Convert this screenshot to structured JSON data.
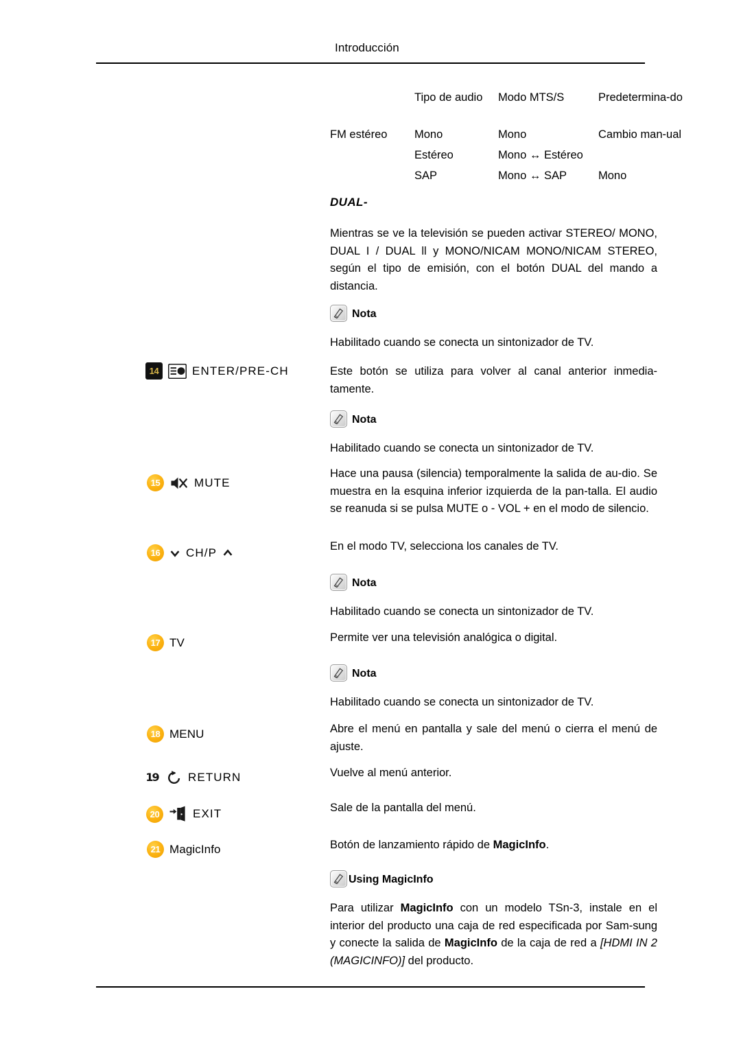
{
  "header": {
    "title": "Introducción"
  },
  "audio_table": {
    "columns": [
      "",
      "Tipo de audio",
      "Modo MTS/S",
      "Predetermina-do"
    ],
    "header_cells": {
      "type": "Tipo de audio",
      "mode": "Modo MTS/S",
      "default": "Predetermina-do"
    },
    "row_label": "FM estéreo",
    "rows": [
      {
        "audio_type": "Mono",
        "mts_mode": "Mono",
        "default": "Cambio  man-ual"
      },
      {
        "audio_type": "Estéreo",
        "mts_mode": "Mono ↔ Estéreo",
        "default": ""
      },
      {
        "audio_type": "SAP",
        "mts_mode": "Mono ↔ SAP",
        "default": "Mono"
      }
    ]
  },
  "dual_section": {
    "heading": "DUAL-",
    "paragraph": "Mientras se ve la televisión se pueden activar STEREO/ MONO, DUAL I / DUAL ll y MONO/NICAM MONO/NICAM STEREO, según el tipo de emisión, con el botón DUAL del mando a distancia."
  },
  "notes": {
    "label": "Nota",
    "tuner_text": "Habilitado cuando se conecta un sintonizador de TV."
  },
  "entries": [
    {
      "id": "enter-pre-ch",
      "badge": "14",
      "badge_style": "dark",
      "icon": "channel-list-icon",
      "label": "ENTER/PRE-CH",
      "description": "Este botón se utiliza para volver al canal anterior inmedia-tamente."
    },
    {
      "id": "mute",
      "badge": "15",
      "badge_style": "orange",
      "icon": "speaker-mute-icon",
      "label": "MUTE",
      "description": "Hace una pausa (silencia) temporalmente la salida de au-dio. Se muestra en la esquina inferior izquierda de la pan-talla. El audio se reanuda si se pulsa MUTE o - VOL + en el modo de silencio."
    },
    {
      "id": "ch-p",
      "badge": "16",
      "badge_style": "orange",
      "icon": "chevron-down-icon",
      "icon_right": "chevron-up-icon",
      "label": "CH/P",
      "description": "En el modo TV, selecciona los canales de TV.",
      "description_bold": "TV"
    },
    {
      "id": "tv",
      "badge": "17",
      "badge_style": "orange",
      "label": "TV",
      "description": "Permite ver una televisión analógica o digital."
    },
    {
      "id": "menu",
      "badge": "18",
      "badge_style": "orange",
      "label": "MENU",
      "description": "Abre el menú en pantalla y sale del menú o cierra el menú de ajuste."
    },
    {
      "id": "return",
      "badge": "19",
      "badge_style": "glitch",
      "icon": "return-arrow-icon",
      "label": "RETURN",
      "description": "Vuelve al menú anterior."
    },
    {
      "id": "exit",
      "badge": "20",
      "badge_style": "orange",
      "icon": "exit-door-icon",
      "label": "EXIT",
      "description": "Sale de la pantalla del menú."
    },
    {
      "id": "magicinfo",
      "badge": "21",
      "badge_style": "orange",
      "label": "MagicInfo",
      "description_prefix": "Botón de lanzamiento rápido de ",
      "description_bold": "MagicInfo",
      "description_suffix": "."
    }
  ],
  "magicinfo_note": {
    "heading": "Using MagicInfo",
    "part1": "Para utilizar ",
    "bold1": "MagicInfo",
    "part2": " con un modelo TSn-3, instale en el interior del producto una caja de red especificada por Sam-sung y conecte la salida de ",
    "bold2": "MagicInfo",
    "part3": " de la caja de red a ",
    "italic1": "[HDMI IN 2 (MAGICINFO)]",
    "part4": " del producto."
  }
}
